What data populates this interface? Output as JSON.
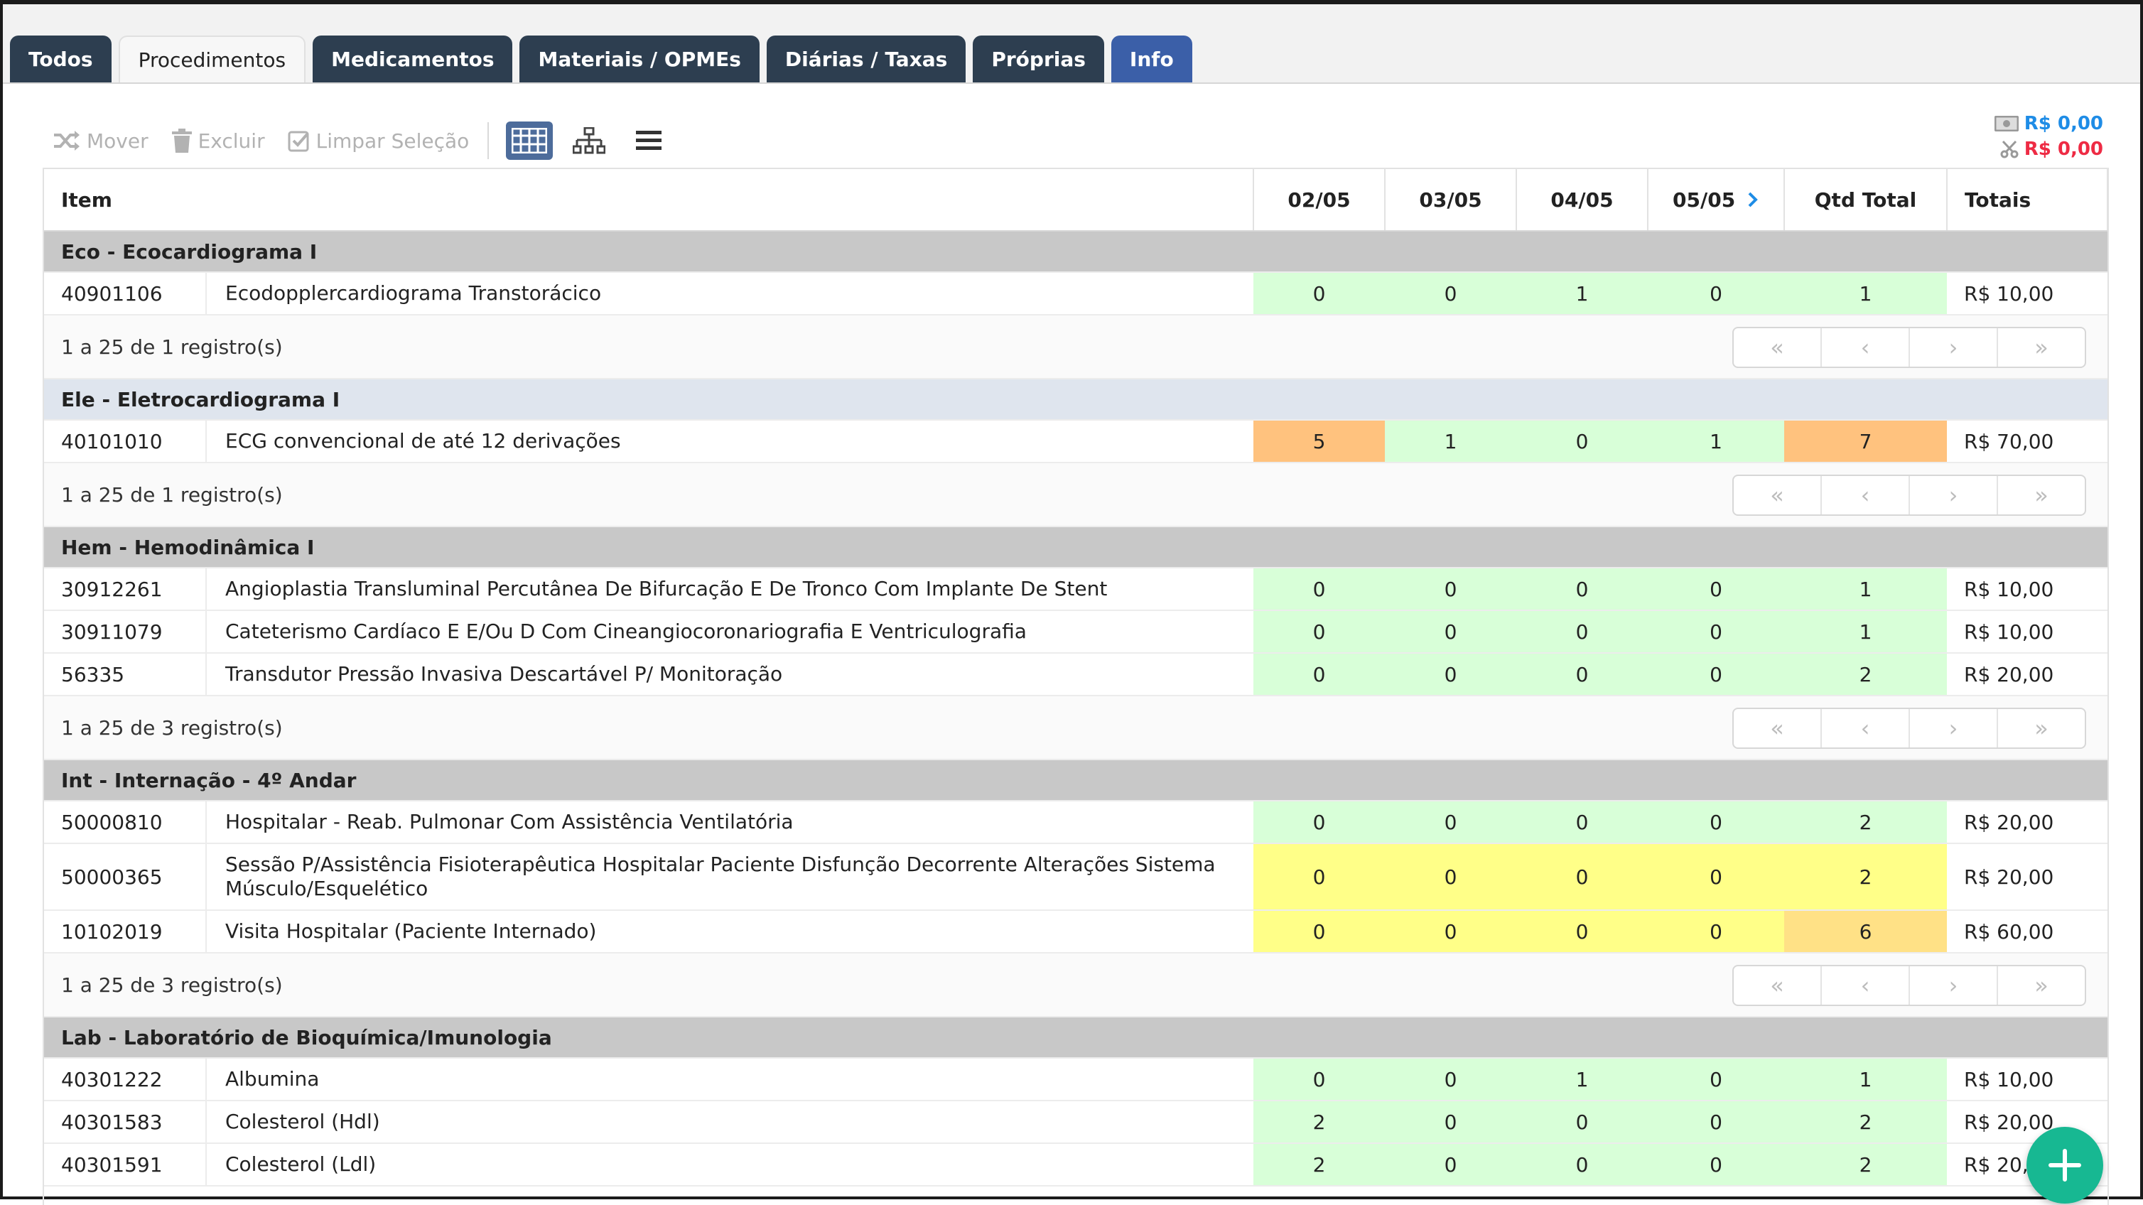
{
  "tabs": [
    {
      "label": "Todos",
      "active": false
    },
    {
      "label": "Procedimentos",
      "active": true
    },
    {
      "label": "Medicamentos",
      "active": false
    },
    {
      "label": "Materiais / OPMEs",
      "active": false
    },
    {
      "label": "Diárias / Taxas",
      "active": false
    },
    {
      "label": "Próprias",
      "active": false
    },
    {
      "label": "Info",
      "active": false
    }
  ],
  "toolbar": {
    "move_label": "Mover",
    "delete_label": "Excluir",
    "clear_label": "Limpar Seleção"
  },
  "totals": {
    "cost_value": "R$ 0,00",
    "discount_value": "R$ 0,00"
  },
  "columns": {
    "item": "Item",
    "days": [
      "02/05",
      "03/05",
      "04/05",
      "05/05"
    ],
    "qty_total": "Qtd Total",
    "totals": "Totais"
  },
  "groups": [
    {
      "title": "Eco - Ecocardiograma I",
      "pager": "1 a 25 de 1 registro(s)",
      "rows": [
        {
          "code": "40901106",
          "desc": "Ecodopplercardiograma Transtorácico",
          "days": [
            "0",
            "0",
            "1",
            "0"
          ],
          "qty": "1",
          "total": "R$ 10,00"
        }
      ]
    },
    {
      "title": "Ele - Eletrocardiograma I",
      "pager": "1 a 25 de 1 registro(s)",
      "rows": [
        {
          "code": "40101010",
          "desc": "ECG convencional de até 12 derivações",
          "days": [
            "5",
            "1",
            "0",
            "1"
          ],
          "qty": "7",
          "total": "R$ 70,00"
        }
      ]
    },
    {
      "title": "Hem - Hemodinâmica I",
      "pager": "1 a 25 de 3 registro(s)",
      "rows": [
        {
          "code": "30912261",
          "desc": "Angioplastia Transluminal Percutânea De Bifurcação E De Tronco Com Implante De Stent",
          "days": [
            "0",
            "0",
            "0",
            "0"
          ],
          "qty": "1",
          "total": "R$ 10,00"
        },
        {
          "code": "30911079",
          "desc": "Cateterismo Cardíaco E E/Ou D Com Cineangiocoronariografia E Ventriculografia",
          "days": [
            "0",
            "0",
            "0",
            "0"
          ],
          "qty": "1",
          "total": "R$ 10,00"
        },
        {
          "code": "56335",
          "desc": "Transdutor Pressão Invasiva Descartável P/ Monitoração",
          "days": [
            "0",
            "0",
            "0",
            "0"
          ],
          "qty": "2",
          "total": "R$ 20,00"
        }
      ]
    },
    {
      "title": "Int - Internação - 4º Andar",
      "pager": "1 a 25 de 3 registro(s)",
      "rows": [
        {
          "code": "50000810",
          "desc": "Hospitalar - Reab. Pulmonar Com Assistência Ventilatória",
          "days": [
            "0",
            "0",
            "0",
            "0"
          ],
          "qty": "2",
          "total": "R$ 20,00"
        },
        {
          "code": "50000365",
          "desc": "Sessão P/Assistência Fisioterapêutica Hospitalar Paciente Disfunção Decorrente Alterações Sistema Músculo/Esquelético",
          "days": [
            "0",
            "0",
            "0",
            "0"
          ],
          "qty": "2",
          "total": "R$ 20,00"
        },
        {
          "code": "10102019",
          "desc": "Visita Hospitalar (Paciente Internado)",
          "days": [
            "0",
            "0",
            "0",
            "0"
          ],
          "qty": "6",
          "total": "R$ 60,00"
        }
      ]
    },
    {
      "title": "Lab - Laboratório de Bioquímica/Imunologia",
      "pager": "",
      "rows": [
        {
          "code": "40301222",
          "desc": "Albumina",
          "days": [
            "0",
            "0",
            "1",
            "0"
          ],
          "qty": "1",
          "total": "R$ 10,00"
        },
        {
          "code": "40301583",
          "desc": "Colesterol (Hdl)",
          "days": [
            "2",
            "0",
            "0",
            "0"
          ],
          "qty": "2",
          "total": "R$ 20,00"
        },
        {
          "code": "40301591",
          "desc": "Colesterol (Ldl)",
          "days": [
            "2",
            "0",
            "0",
            "0"
          ],
          "qty": "2",
          "total": "R$ 20,00"
        }
      ]
    }
  ],
  "colors": {
    "tab_dark": "#2d3e50",
    "tab_info": "#3b5fa8",
    "cell_green": "#d8ffd8",
    "cell_yellow": "#ffff88",
    "cell_orange": "#ffc27e",
    "fab": "#17b892"
  },
  "icons": {
    "move": "shuffle-icon",
    "delete": "trash-icon",
    "clear": "checkbox-icon",
    "view_grid": "grid-view-icon",
    "view_tree": "sitemap-icon",
    "view_list": "list-icon",
    "fab": "plus-icon"
  }
}
